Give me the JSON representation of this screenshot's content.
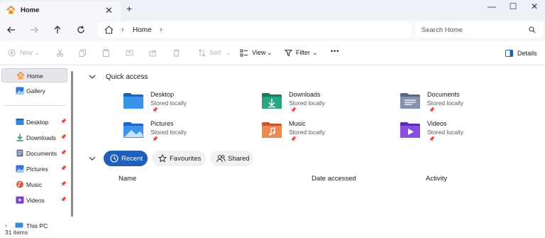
{
  "window": {
    "tab_title": "Home",
    "tab_close": "✕",
    "new_tab": "+",
    "minimize": "—",
    "maximize": "☐",
    "close": "✕"
  },
  "address": {
    "crumbs": [
      "Home"
    ],
    "separator": "›",
    "search_placeholder": "Search Home"
  },
  "commands": {
    "new": "New",
    "sort": "Sort",
    "view": "View",
    "filter": "Filter",
    "more": "•••",
    "details": "Details"
  },
  "sidebar": {
    "top": [
      {
        "label": "Home",
        "icon": "home-icon",
        "selected": true
      },
      {
        "label": "Gallery",
        "icon": "gallery-icon"
      }
    ],
    "pinned": [
      {
        "label": "Desktop",
        "icon": "desktop-icon",
        "pin": "📌"
      },
      {
        "label": "Downloads",
        "icon": "downloads-icon",
        "pin": "📌"
      },
      {
        "label": "Documents",
        "icon": "documents-icon",
        "pin": "📌"
      },
      {
        "label": "Pictures",
        "icon": "pictures-icon",
        "pin": "📌"
      },
      {
        "label": "Music",
        "icon": "music-icon",
        "pin": "📌"
      },
      {
        "label": "Videos",
        "icon": "videos-icon",
        "pin": "📌"
      }
    ],
    "this_pc": "This PC"
  },
  "quick_access": {
    "title": "Quick access",
    "items": [
      {
        "name": "Desktop",
        "sub": "Stored locally",
        "icon": "desktop-folder-icon"
      },
      {
        "name": "Downloads",
        "sub": "Stored locally",
        "icon": "downloads-folder-icon"
      },
      {
        "name": "Documents",
        "sub": "Stored locally",
        "icon": "documents-folder-icon"
      },
      {
        "name": "Pictures",
        "sub": "Stored locally",
        "icon": "pictures-folder-icon"
      },
      {
        "name": "Music",
        "sub": "Stored locally",
        "icon": "music-folder-icon"
      },
      {
        "name": "Videos",
        "sub": "Stored locally",
        "icon": "videos-folder-icon"
      }
    ],
    "pin": "📌"
  },
  "recent": {
    "tabs": [
      {
        "label": "Recent",
        "icon": "clock-icon",
        "active": true
      },
      {
        "label": "Favourites",
        "icon": "star-icon"
      },
      {
        "label": "Shared",
        "icon": "people-icon"
      }
    ],
    "columns": [
      "Name",
      "Date accessed",
      "Activity"
    ]
  },
  "status": {
    "item_count": "31 items"
  },
  "colors": {
    "accent": "#1f5fb8",
    "titlebar": "#eef0f8"
  }
}
